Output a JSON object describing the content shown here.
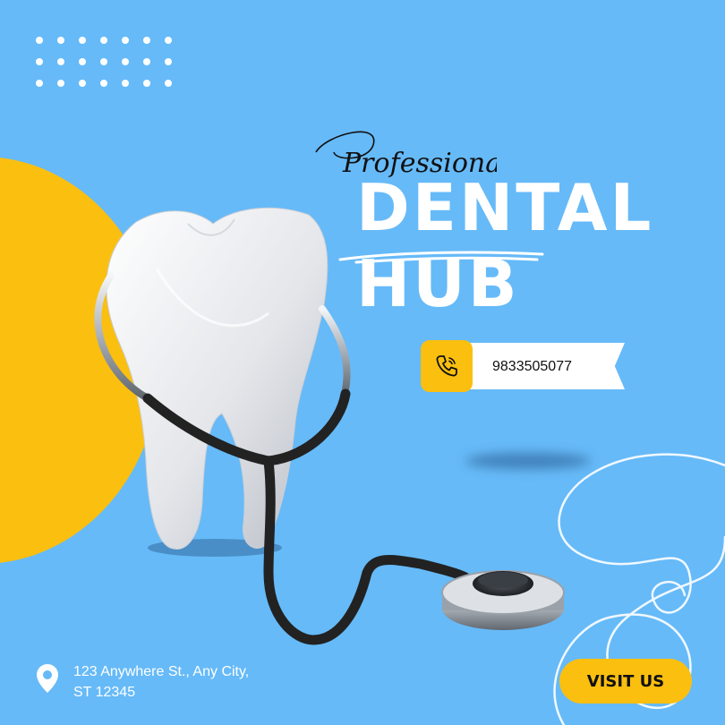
{
  "brand": {
    "script_title": "Professional",
    "title_line1": "DENTAL",
    "title_line2": "HUB"
  },
  "contact": {
    "phone_icon": "phone-icon",
    "phone": "9833505077",
    "location_icon": "location-pin-icon",
    "address_line1": "123 Anywhere St., Any City,",
    "address_line2": "ST 12345"
  },
  "cta": {
    "visit_label": "VISIT US"
  },
  "colors": {
    "background": "#66baf8",
    "accent_yellow": "#fbbf0f",
    "text_white": "#ffffff",
    "text_dark": "#111111"
  },
  "illustration": "tooth-with-stethoscope"
}
